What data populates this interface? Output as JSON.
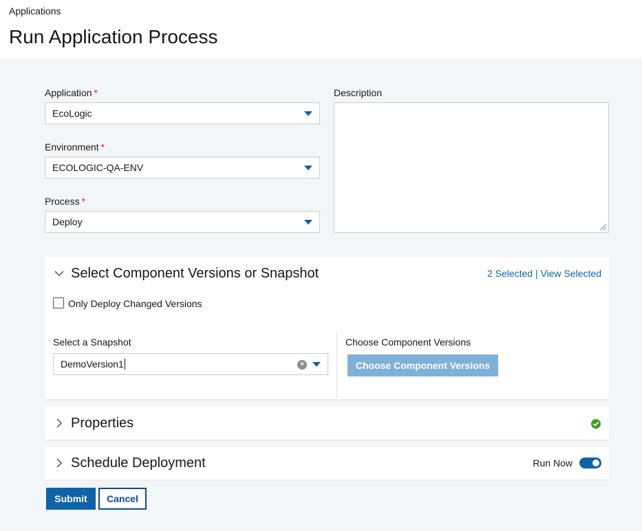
{
  "breadcrumb": "Applications",
  "page_title": "Run Application Process",
  "form": {
    "application": {
      "label": "Application",
      "required_mark": "*",
      "value": "EcoLogic"
    },
    "environment": {
      "label": "Environment",
      "required_mark": "*",
      "value": "ECOLOGIC-QA-ENV"
    },
    "process": {
      "label": "Process",
      "required_mark": "*",
      "value": "Deploy"
    },
    "description": {
      "label": "Description",
      "value": ""
    }
  },
  "versions_panel": {
    "title": "Select Component Versions or Snapshot",
    "selected_count": "2 Selected",
    "separator": "|",
    "view_selected": "View Selected",
    "checkbox_label": "Only Deploy Changed Versions",
    "checkbox_checked": false,
    "snapshot_label": "Select a Snapshot",
    "snapshot_value": "DemoVersion1",
    "component_label": "Choose Component Versions",
    "component_button": "Choose Component Versions"
  },
  "properties_panel": {
    "title": "Properties",
    "status_icon": "check-circle-icon"
  },
  "schedule_panel": {
    "title": "Schedule Deployment",
    "run_now_label": "Run Now",
    "run_now_on": true
  },
  "actions": {
    "submit": "Submit",
    "cancel": "Cancel"
  },
  "colors": {
    "primary": "#0f62a8",
    "required": "#da1e28",
    "success": "#3e9b24",
    "disabled_button": "#7fb0d8"
  }
}
